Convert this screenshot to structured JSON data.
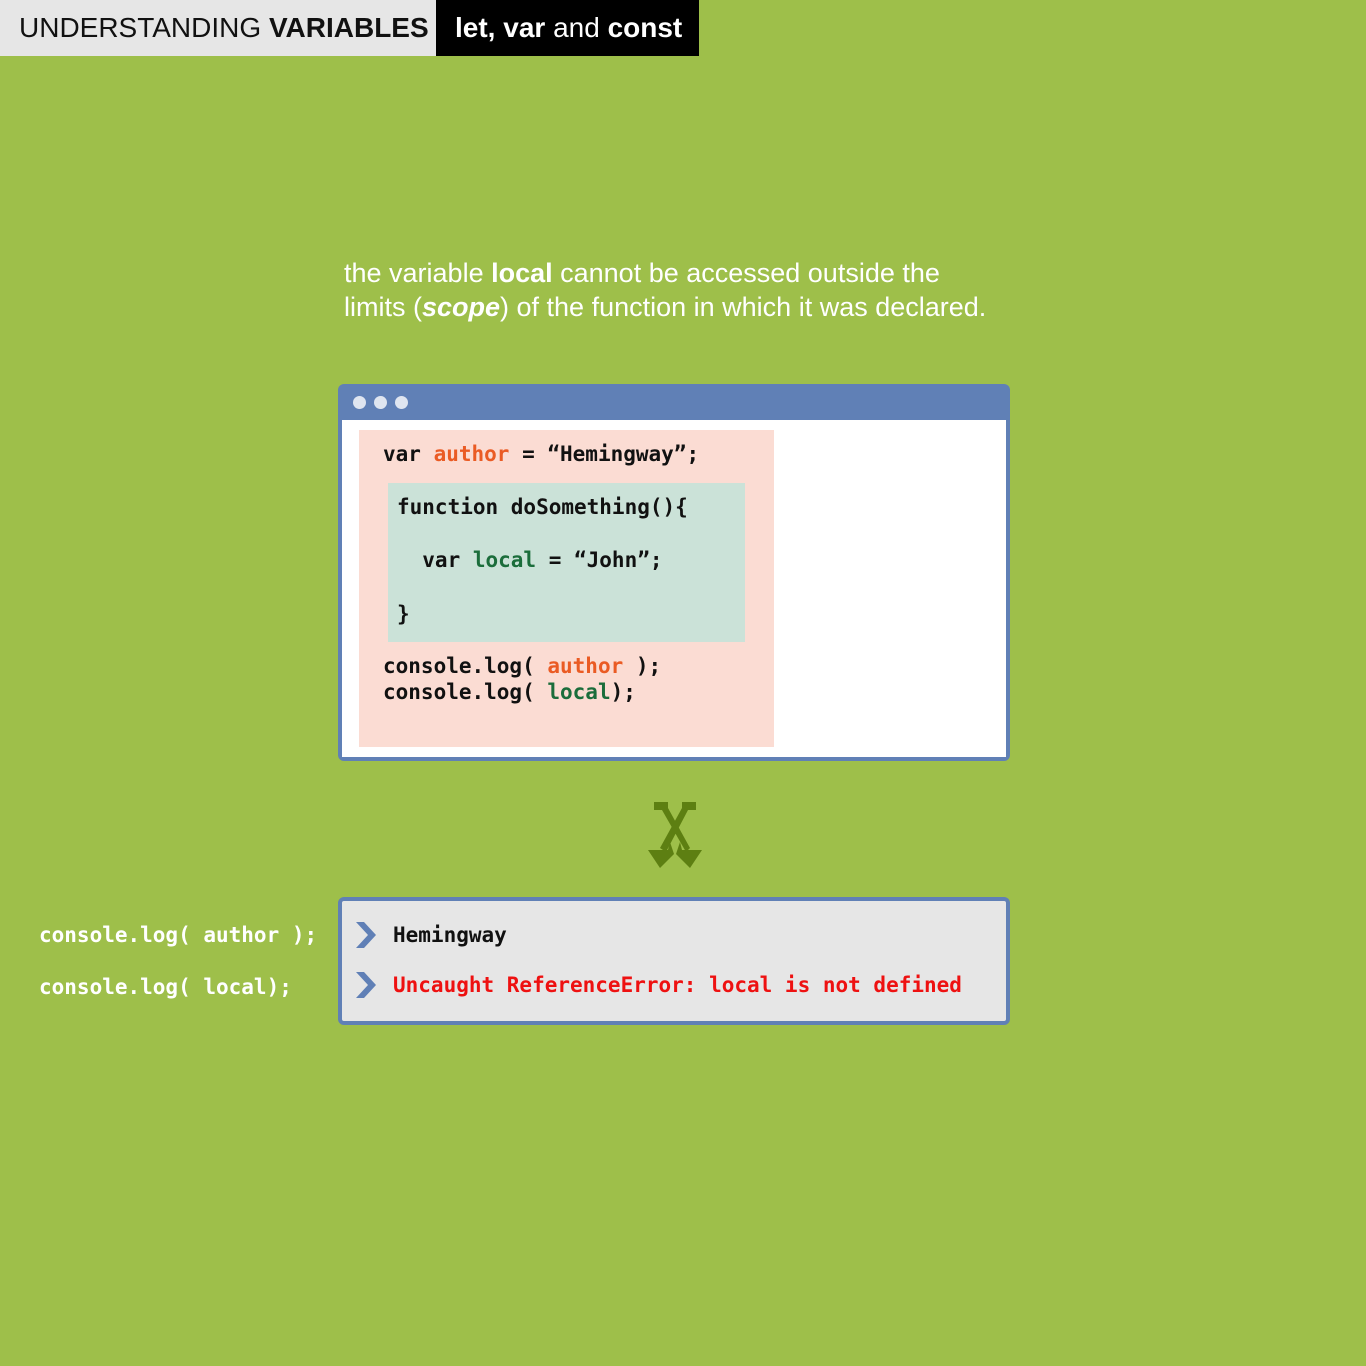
{
  "header": {
    "tab1_part1": "UNDERSTANDING ",
    "tab1_part2": "VARIABLES",
    "tab2_let": "let,",
    "tab2_var": " var",
    "tab2_and": " and ",
    "tab2_const": "const"
  },
  "caption": {
    "line1_a": "the variable ",
    "line1_b": "local",
    "line1_c": " cannot be accessed outside the",
    "line2_a": "limits (",
    "line2_b": "scope",
    "line2_c": ") of the function in which it was declared."
  },
  "code": {
    "l1_kw": "var ",
    "l1_var": "author",
    "l1_rest": " = “Hemingway”;",
    "l2": "function doSomething(){",
    "l3_kw": "  var ",
    "l3_var": "local",
    "l3_rest": " = “John”;",
    "l4": "}",
    "l5_a": "console.log( ",
    "l5_var": "author",
    "l5_b": " );",
    "l6_a": "console.log( ",
    "l6_var": "local",
    "l6_b": ");"
  },
  "console": {
    "out1": "Hemingway",
    "out2": "Uncaught ReferenceError: local is not defined"
  },
  "side": {
    "line1": "console.log( author );",
    "line2": "console.log( local);"
  },
  "colors": {
    "background": "#9ebf4a",
    "window": "#6080b6",
    "outer_scope": "#fbdcd3",
    "inner_scope": "#cbe2d8",
    "author": "#ea5b24",
    "local": "#1b6d3b",
    "error": "#ee1111"
  },
  "icons": {
    "arrow": "crossed-arrows-down-icon",
    "prompt": "chevron-right-icon"
  }
}
